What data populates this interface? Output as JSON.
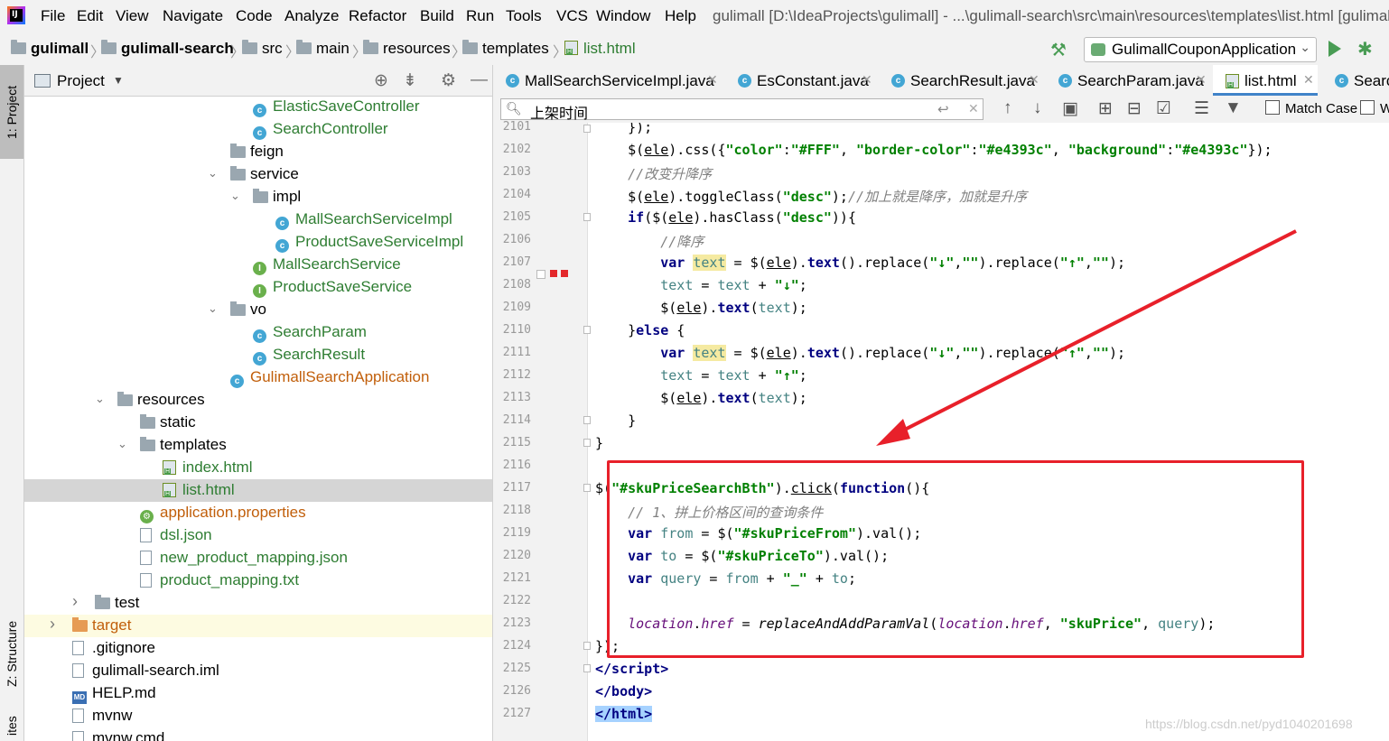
{
  "menubar": {
    "items": [
      "File",
      "Edit",
      "View",
      "Navigate",
      "Code",
      "Analyze",
      "Refactor",
      "Build",
      "Run",
      "Tools",
      "VCS",
      "Window",
      "Help"
    ],
    "window_title": "gulimall [D:\\IdeaProjects\\gulimall] - ...\\gulimall-search\\src\\main\\resources\\templates\\list.html [gulimall-"
  },
  "breadcrumb": {
    "items": [
      "gulimall",
      "gulimall-search",
      "src",
      "main",
      "resources",
      "templates",
      "list.html"
    ]
  },
  "run_config": {
    "label": "GulimallCouponApplication"
  },
  "left_strip": {
    "project_tab": "1: Project",
    "structure_tab": "Z: Structure",
    "favorites_tab": "ites"
  },
  "project_panel": {
    "title": "Project",
    "tree": [
      {
        "label": "ElasticSaveController",
        "type": "class"
      },
      {
        "label": "SearchController",
        "type": "class"
      },
      {
        "label": "feign",
        "type": "folder"
      },
      {
        "label": "service",
        "type": "folder"
      },
      {
        "label": "impl",
        "type": "folder"
      },
      {
        "label": "MallSearchServiceImpl",
        "type": "class"
      },
      {
        "label": "ProductSaveServiceImpl",
        "type": "class"
      },
      {
        "label": "MallSearchService",
        "type": "interface"
      },
      {
        "label": "ProductSaveService",
        "type": "interface"
      },
      {
        "label": "vo",
        "type": "folder"
      },
      {
        "label": "SearchParam",
        "type": "class"
      },
      {
        "label": "SearchResult",
        "type": "class"
      },
      {
        "label": "GulimallSearchApplication",
        "type": "app"
      },
      {
        "label": "resources",
        "type": "folder"
      },
      {
        "label": "static",
        "type": "folder"
      },
      {
        "label": "templates",
        "type": "folder"
      },
      {
        "label": "index.html",
        "type": "html"
      },
      {
        "label": "list.html",
        "type": "html"
      },
      {
        "label": "application.properties",
        "type": "props"
      },
      {
        "label": "dsl.json",
        "type": "file"
      },
      {
        "label": "new_product_mapping.json",
        "type": "file"
      },
      {
        "label": "product_mapping.txt",
        "type": "file"
      },
      {
        "label": "test",
        "type": "folder"
      },
      {
        "label": "target",
        "type": "folder"
      },
      {
        "label": ".gitignore",
        "type": "file"
      },
      {
        "label": "gulimall-search.iml",
        "type": "file"
      },
      {
        "label": "HELP.md",
        "type": "md"
      },
      {
        "label": "mvnw",
        "type": "file"
      },
      {
        "label": "mvnw.cmd",
        "type": "file"
      }
    ]
  },
  "tabs": [
    "MallSearchServiceImpl.java",
    "EsConstant.java",
    "SearchResult.java",
    "SearchParam.java",
    "list.html",
    "Searc"
  ],
  "find": {
    "query": "上架时间",
    "match_case": "Match Case",
    "words": "W"
  },
  "line_numbers": [
    "2101",
    "2102",
    "2103",
    "2104",
    "2105",
    "2106",
    "2107",
    "2108",
    "2109",
    "2110",
    "2111",
    "2112",
    "2113",
    "2114",
    "2115",
    "2116",
    "2117",
    "2118",
    "2119",
    "2120",
    "2121",
    "2122",
    "2123",
    "2124",
    "2125",
    "2126",
    "2127"
  ],
  "watermark": "https://blog.csdn.net/pyd1040201698"
}
